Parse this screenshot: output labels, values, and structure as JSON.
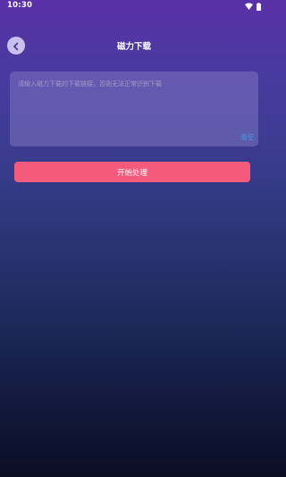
{
  "status_bar": {
    "time": "10:30",
    "icons": [
      "wifi-icon",
      "battery-icon"
    ]
  },
  "header": {
    "title": "磁力下载",
    "back_icon": "chevron-left-icon"
  },
  "input": {
    "placeholder": "请输入磁力下载的下载链接，否则无法正常识别下载",
    "value": "",
    "clear_label": "清空"
  },
  "actions": {
    "start_label": "开始处理"
  },
  "colors": {
    "accent": "#f45a7c",
    "link": "#3aa6ee",
    "back_button": "#c9c0ee"
  }
}
